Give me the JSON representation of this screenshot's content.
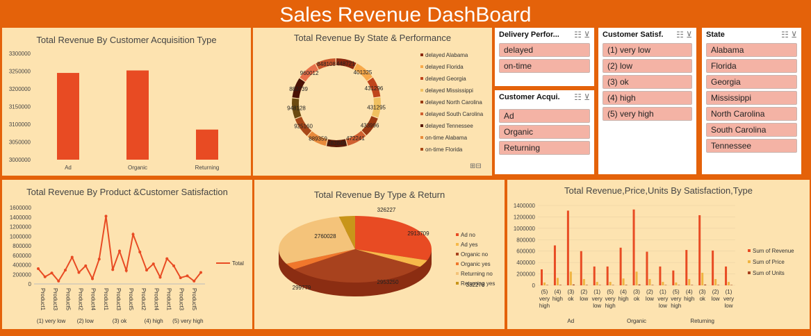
{
  "title": "Sales Revenue DashBoard",
  "colors": {
    "background": "#e4620a",
    "panel": "#fde3b0",
    "bar": "#e84b23",
    "accent": "#f0b441",
    "slicer_item": "#f4b3a5"
  },
  "slicers": {
    "delivery": {
      "header": "Delivery Perfor...",
      "items": [
        "delayed",
        "on-time"
      ]
    },
    "acquisition": {
      "header": "Customer Acqui...",
      "items": [
        "Ad",
        "Organic",
        "Returning"
      ]
    },
    "satisfaction": {
      "header": "Customer Satisf...",
      "items": [
        "(1) very low",
        "(2) low",
        "(3) ok",
        "(4) high",
        "(5) very high"
      ]
    },
    "state": {
      "header": "State",
      "items": [
        "Alabama",
        "Florida",
        "Georgia",
        "Mississippi",
        "North Carolina",
        "South Carolina",
        "Tennessee"
      ]
    },
    "icons": [
      "multi-select-icon",
      "clear-filter-icon"
    ]
  },
  "chart_data": [
    {
      "type": "bar",
      "title": "Total Revenue By Customer Acquisition  Type",
      "categories": [
        "Ad",
        "Organic",
        "Returning"
      ],
      "values": [
        3245000,
        3252000,
        3085000
      ],
      "ylim": [
        3000000,
        3300000
      ],
      "yticks": [
        "3300000",
        "3250000",
        "3200000",
        "3150000",
        "3100000",
        "3050000",
        "3000000"
      ]
    },
    {
      "type": "pie",
      "title": "Total Revenue By State & Performance",
      "labels": [
        "448721",
        "401325",
        "431296",
        "431295",
        "433996",
        "472241",
        "483849",
        "889359",
        "925160",
        "948128",
        "883739",
        "960012",
        "848108"
      ],
      "legend": [
        "delayed Alabama",
        "delayed Florida",
        "delayed Georgia",
        "delayed Mississippi",
        "delayed North Carolina",
        "delayed South Carolina",
        "delayed Tennessee",
        "on-time Alabama",
        "on-time Florida"
      ]
    },
    {
      "type": "line",
      "title": "Total Revenue By Product &Customer Satisfaction",
      "series": [
        {
          "name": "Total",
          "values": [
            320000,
            150000,
            230000,
            60000,
            290000,
            560000,
            240000,
            380000,
            110000,
            520000,
            1420000,
            300000,
            690000,
            280000,
            1040000,
            670000,
            290000,
            420000,
            140000,
            530000,
            380000,
            130000,
            170000,
            60000,
            240000
          ]
        }
      ],
      "yticks": [
        "1600000",
        "1400000",
        "1200000",
        "1000000",
        "800000",
        "600000",
        "400000",
        "200000",
        "0"
      ],
      "xticks": [
        "Product1",
        "Product3",
        "Product5",
        "Product2",
        "Product4",
        "Product1",
        "Product3",
        "Product5",
        "Product2",
        "Product4",
        "Product1",
        "Product3",
        "Product5"
      ],
      "groups": [
        "(1) very low",
        "(2) low",
        "(3) ok",
        "(4) high",
        "(5) very high"
      ]
    },
    {
      "type": "pie",
      "title": "Total Revenue By Type & Return",
      "labels": [
        "2913709",
        "332278",
        "2953250",
        "299779",
        "2760028",
        "326227"
      ],
      "values": [
        2913709,
        332278,
        2953250,
        299779,
        2760028,
        326227
      ],
      "legend": [
        "Ad no",
        "Ad yes",
        "Organic no",
        "Organic yes",
        "Returning no",
        "Returning yes"
      ]
    },
    {
      "type": "bar",
      "title": "Total Revenue,Price,Units By Satisfaction,Type",
      "series": [
        {
          "name": "Sum of Revenue",
          "values": [
            280000,
            700000,
            1310000,
            600000,
            330000,
            330000,
            660000,
            1330000,
            590000,
            330000,
            260000,
            620000,
            1230000,
            610000,
            330000
          ]
        },
        {
          "name": "Sum of Price",
          "values": [
            50000,
            130000,
            240000,
            110000,
            60000,
            60000,
            120000,
            240000,
            110000,
            60000,
            50000,
            110000,
            220000,
            110000,
            60000
          ]
        },
        {
          "name": "Sum of Units",
          "values": [
            3000,
            8000,
            15000,
            7000,
            4000,
            4000,
            8000,
            15000,
            7000,
            4000,
            3000,
            7000,
            14000,
            7000,
            4000
          ]
        }
      ],
      "categories": [
        "(5) very high",
        "(4) high",
        "(3) ok",
        "(2) low",
        "(1) very low",
        "(5) very high",
        "(4) high",
        "(3) ok",
        "(2) low",
        "(1) very low",
        "(5) very high",
        "(4) high",
        "(3) ok",
        "(2) low",
        "(1) very low"
      ],
      "groups": [
        "Ad",
        "Organic",
        "Returning"
      ],
      "yticks": [
        "1400000",
        "1200000",
        "1000000",
        "800000",
        "600000",
        "400000",
        "200000",
        "0"
      ]
    }
  ]
}
